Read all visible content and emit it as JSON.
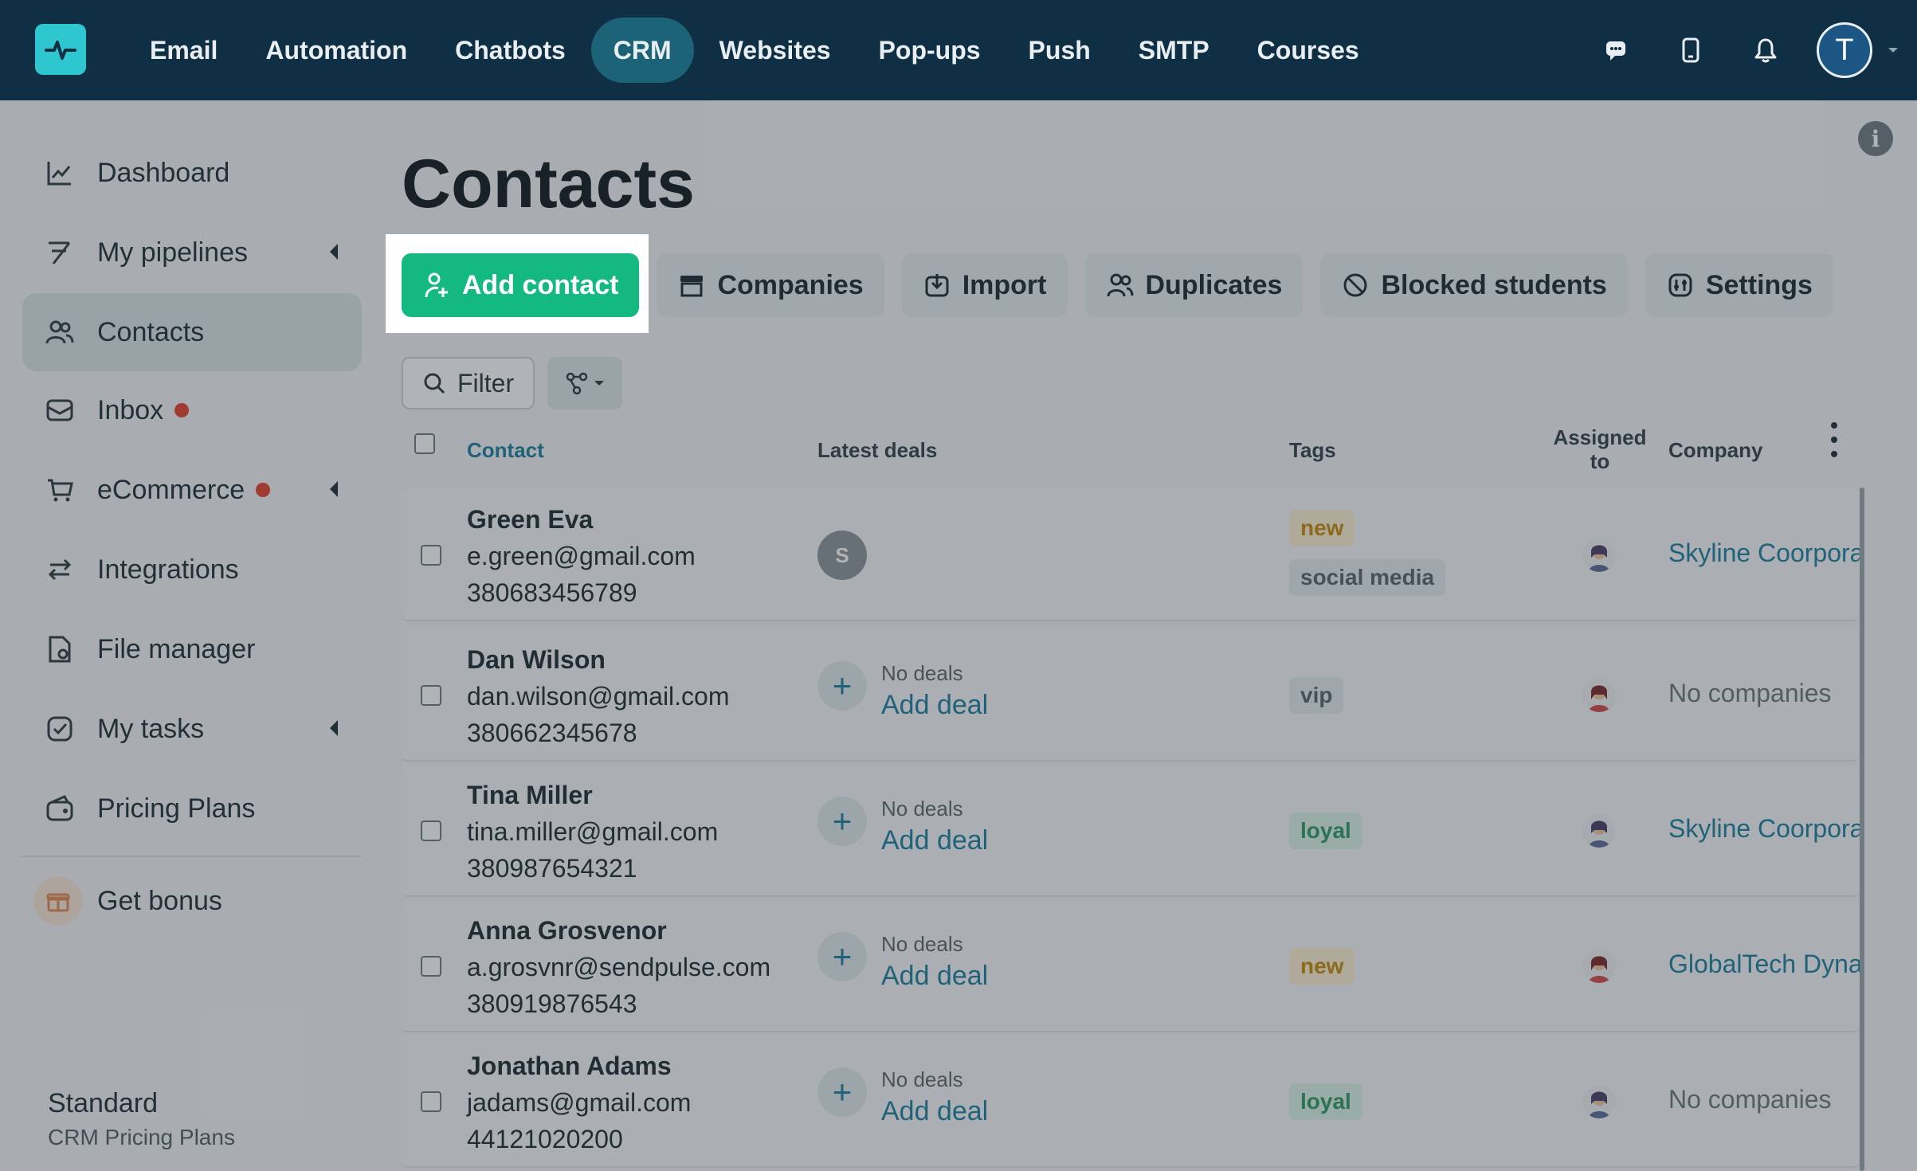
{
  "topnav": {
    "items": [
      "Email",
      "Automation",
      "Chatbots",
      "CRM",
      "Websites",
      "Pop-ups",
      "Push",
      "SMTP",
      "Courses"
    ],
    "active": "CRM",
    "avatar_letter": "T",
    "accent": "#1d6377"
  },
  "sidebar": {
    "items": [
      {
        "label": "Dashboard",
        "icon": "chart-line-icon"
      },
      {
        "label": "My pipelines",
        "icon": "pipeline-icon"
      },
      {
        "label": "Contacts",
        "icon": "users-icon"
      },
      {
        "label": "Inbox",
        "icon": "inbox-icon"
      },
      {
        "label": "eCommerce",
        "icon": "cart-icon"
      },
      {
        "label": "Integrations",
        "icon": "arrows-icon"
      },
      {
        "label": "File manager",
        "icon": "file-icon"
      },
      {
        "label": "My tasks",
        "icon": "checkbox-icon"
      },
      {
        "label": "Pricing Plans",
        "icon": "wallet-icon"
      },
      {
        "label": "Get bonus",
        "icon": "gift-icon"
      }
    ],
    "plan_title": "Standard",
    "plan_sub": "CRM Pricing Plans"
  },
  "main": {
    "title": "Contacts",
    "toolbar": {
      "add_contact": "Add contact",
      "companies": "Companies",
      "import": "Import",
      "duplicates": "Duplicates",
      "blocked": "Blocked students",
      "settings": "Settings"
    },
    "filter_label": "Filter",
    "columns": {
      "contact": "Contact",
      "deals": "Latest deals",
      "tags": "Tags",
      "assigned": "Assigned to",
      "company": "Company"
    },
    "no_deals": "No deals",
    "add_deal": "Add deal",
    "rows": [
      {
        "name": "Green Eva",
        "email": "e.green@gmail.com",
        "phone": "380683456789",
        "deal": "S",
        "tags": [
          "new",
          "social media"
        ],
        "company": "Skyline Coorporation"
      },
      {
        "name": "Dan Wilson",
        "email": "dan.wilson@gmail.com",
        "phone": "380662345678",
        "tags": [
          "vip"
        ],
        "company": "No companies"
      },
      {
        "name": "Tina Miller",
        "email": "tina.miller@gmail.com",
        "phone": "380987654321",
        "tags": [
          "loyal"
        ],
        "company": "Skyline Coorporation"
      },
      {
        "name": "Anna Grosvenor",
        "email": "a.grosvnr@sendpulse.com",
        "phone": "380919876543",
        "tags": [
          "new"
        ],
        "company": "GlobalTech Dynamics"
      },
      {
        "name": "Jonathan Adams",
        "email": "jadams@gmail.com",
        "phone": "44121020200",
        "tags": [
          "loyal"
        ],
        "company": "No companies"
      }
    ]
  }
}
